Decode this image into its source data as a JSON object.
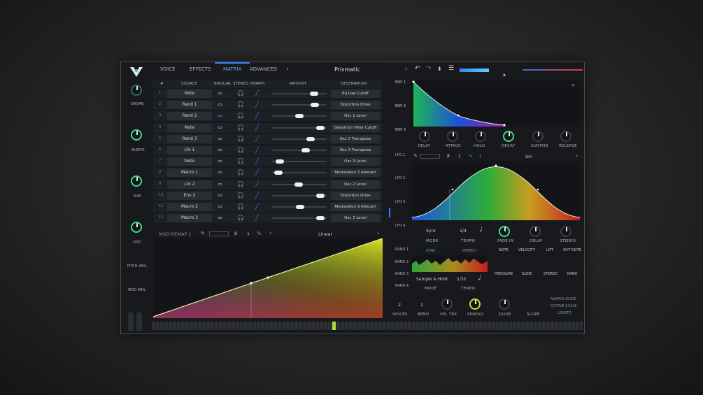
{
  "header": {
    "tabs": [
      "VOICE",
      "EFFECTS",
      "MATRIX",
      "ADVANCED"
    ],
    "active_tab": "MATRIX",
    "preset_name": "Prismatic"
  },
  "left_strip": {
    "items": [
      "GROAN",
      "BLEEPS",
      "SUB",
      "DIST",
      "PITCH WHL",
      "MOD WHL"
    ]
  },
  "matrix": {
    "columns": {
      "num": "#",
      "source": "SOURCE",
      "bipolar": "BIPOLAR",
      "stereo": "STEREO",
      "morph": "MORPH",
      "amount": "AMOUNT",
      "destination": "DESTINATION"
    },
    "rows": [
      {
        "n": "1",
        "source": "Note",
        "bipolar": false,
        "amount": 0.82,
        "dest": "Eq Low Cutoff"
      },
      {
        "n": "2",
        "source": "Rand 1",
        "bipolar": false,
        "amount": 0.84,
        "dest": "Distortion Drive"
      },
      {
        "n": "3",
        "source": "Rand 2",
        "bipolar": true,
        "amount": 0.5,
        "dest": "Osc 1 Level"
      },
      {
        "n": "4",
        "source": "Note",
        "bipolar": false,
        "amount": 0.96,
        "dest": "Distortion Filter Cutoff"
      },
      {
        "n": "5",
        "source": "Rand 3",
        "bipolar": false,
        "amount": 0.74,
        "dest": "Osc 2 Transpose"
      },
      {
        "n": "6",
        "source": "Lfo 1",
        "bipolar": false,
        "amount": 0.63,
        "dest": "Osc 3 Transpose"
      },
      {
        "n": "7",
        "source": "Note",
        "bipolar": false,
        "amount": 0.08,
        "dest": "Osc 3 Level"
      },
      {
        "n": "8",
        "source": "Macro 1",
        "bipolar": false,
        "amount": 0.05,
        "dest": "Modulation 3 Amount"
      },
      {
        "n": "9",
        "source": "Lfo 2",
        "bipolar": false,
        "amount": 0.48,
        "dest": "Osc 2 Level"
      },
      {
        "n": "10",
        "source": "Env 2",
        "bipolar": false,
        "amount": 0.96,
        "dest": "Distortion Drive"
      },
      {
        "n": "11",
        "source": "Macro 2",
        "bipolar": false,
        "amount": 0.52,
        "dest": "Modulation 9 Amount"
      },
      {
        "n": "12",
        "source": "Macro 3",
        "bipolar": false,
        "amount": 0.96,
        "dest": "Osc 3 Level"
      }
    ]
  },
  "remap": {
    "title": "MOD REMAP 1",
    "grid_x": "8",
    "grid_y": "1",
    "curve": "Linear"
  },
  "env": {
    "tabs": [
      "ENV 1",
      "ENV 2",
      "ENV 3"
    ],
    "knobs": [
      "DELAY",
      "ATTACK",
      "HOLD",
      "DECAY",
      "SUSTAIN",
      "RELEASE"
    ]
  },
  "lfo": {
    "tabs": [
      "LFO 1",
      "LFO 2",
      "LFO 3",
      "LFO 4"
    ],
    "grid_x": "8",
    "grid_y": "1",
    "shape": "Sin",
    "sync": "Sync",
    "tempo": "1/4",
    "labels": [
      "MODE",
      "TEMPO",
      "FADE IN",
      "DELAY",
      "STEREO"
    ]
  },
  "random": {
    "tabs": [
      "RAND 1",
      "RAND 2",
      "RAND 3",
      "RAND 4"
    ],
    "sync_btn": "SYNC",
    "stereo_btn": "STEREO",
    "mode": "Sample & Hold",
    "tempo": "1/32",
    "mode_label": "MODE",
    "tempo_label": "TEMPO"
  },
  "mpe": {
    "columns": [
      "NOTE",
      "VELOCITY",
      "LIFT",
      "OCT NOTE"
    ],
    "sub": [
      "PRESSURE",
      "SLIDE",
      "STEREO",
      "RAND"
    ]
  },
  "voice": {
    "voices": "2",
    "bend": "2",
    "labels": [
      "VOICES",
      "BEND",
      "VEL TRK",
      "SPREAD",
      "GLIDE",
      "SLOPE"
    ],
    "options": [
      "ALWAYS GLIDE",
      "OCTAVE SCALE",
      "LEGATO"
    ]
  },
  "colors": {
    "accent": "#3b82f6",
    "green": "#3ddc84",
    "bg": "#17191d"
  }
}
